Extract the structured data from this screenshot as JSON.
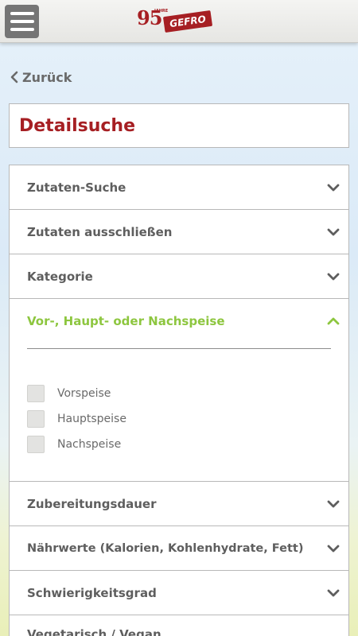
{
  "header": {
    "menu_icon": "hamburger-menu-icon",
    "logo": {
      "number": "95",
      "small": "JAHRE",
      "brand": "GEFRO"
    }
  },
  "nav": {
    "back_label": "Zurück",
    "back_icon": "chevron-left-icon"
  },
  "page": {
    "title": "Detailsuche"
  },
  "accordion": {
    "sections_before": [
      {
        "label": "Zutaten-Suche"
      },
      {
        "label": "Zutaten ausschließen"
      },
      {
        "label": "Kategorie"
      }
    ],
    "open_section": {
      "label": "Vor-, Haupt- oder Nachspeise",
      "options": [
        {
          "label": "Vorspeise",
          "checked": false
        },
        {
          "label": "Hauptspeise",
          "checked": false
        },
        {
          "label": "Nachspeise",
          "checked": false
        }
      ]
    },
    "sections_after": [
      {
        "label": "Zubereitungsdauer"
      },
      {
        "label": "Nährwerte (Kalorien, Kohlenhydrate, Fett)"
      },
      {
        "label": "Schwierigkeitsgrad"
      },
      {
        "label": "Vegetarisch / Vegan"
      }
    ]
  },
  "colors": {
    "brand_red": "#a61f23",
    "accent_green": "#8dc63f",
    "text_gray": "#5e5e5e"
  }
}
